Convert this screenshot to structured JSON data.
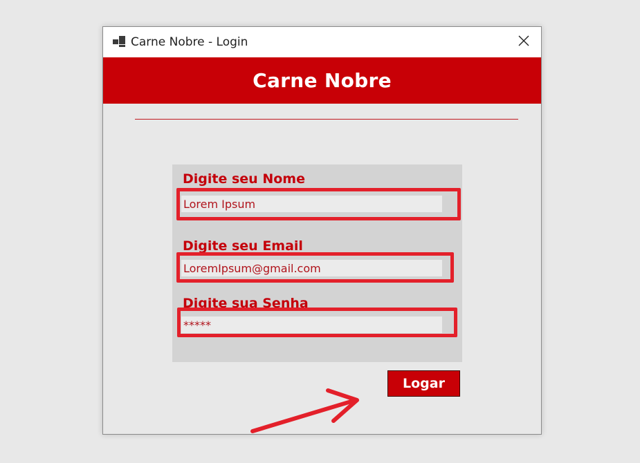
{
  "window": {
    "title": "Carne Nobre - Login",
    "icon": "app-window-icon",
    "close_icon": "close-icon"
  },
  "header": {
    "title": "Carne Nobre",
    "background_color": "#c80006"
  },
  "form": {
    "name": {
      "label": "Digite seu Nome",
      "value": "Lorem Ipsum"
    },
    "email": {
      "label": "Digite seu Email",
      "value": "LoremIpsum@gmail.com"
    },
    "password": {
      "label": "Digite sua Senha",
      "value": "*****"
    },
    "label_color": "#c4000a"
  },
  "actions": {
    "login_label": "Logar"
  },
  "annotations": {
    "highlight_color": "#e3202a",
    "arrow_icon": "red-arrow-annotation"
  }
}
